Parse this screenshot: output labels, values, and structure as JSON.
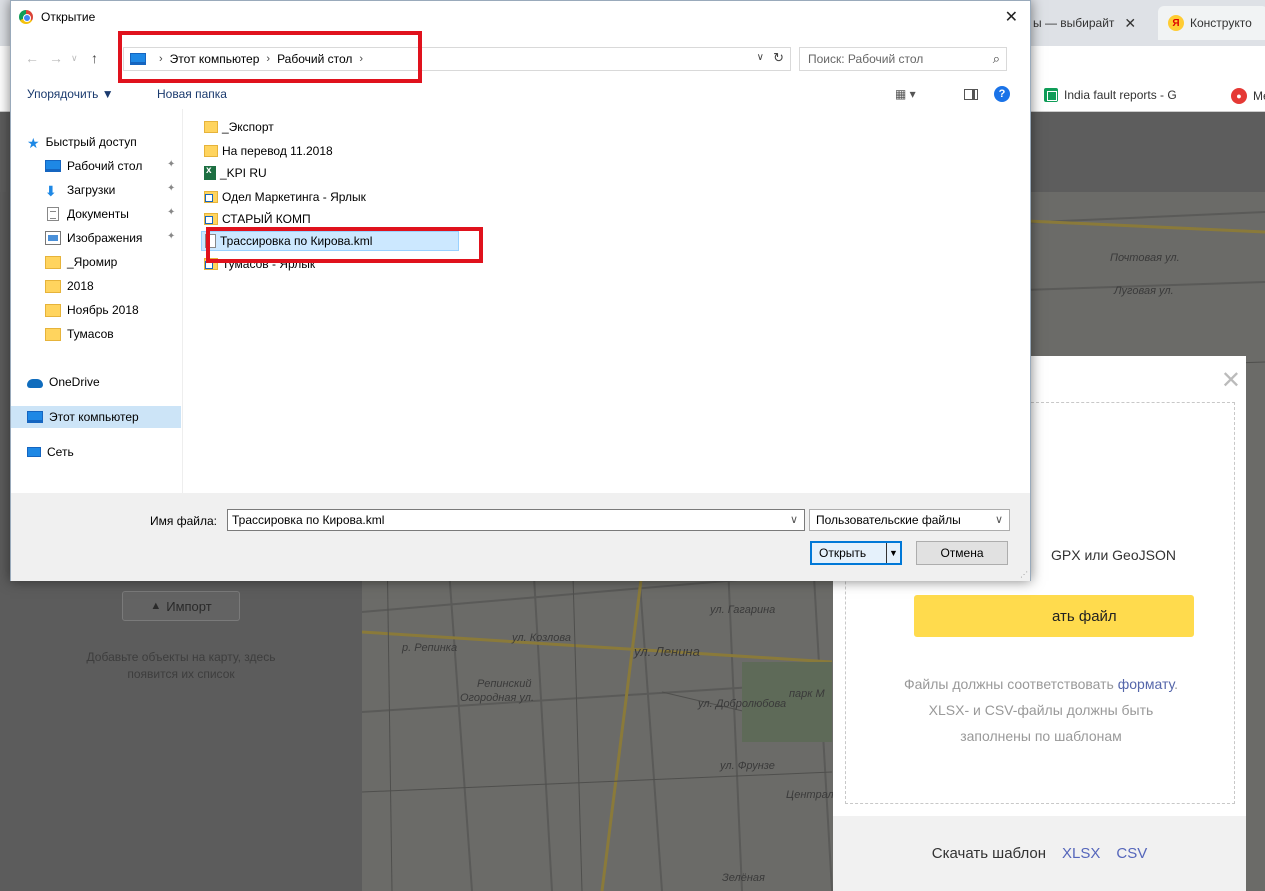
{
  "browser": {
    "tabs": [
      {
        "label": "ы — выбирайт",
        "close": "✕"
      },
      {
        "label": "Конструкто"
      }
    ],
    "bookmarks": [
      {
        "label": "India fault reports - G"
      },
      {
        "label": "Me"
      }
    ]
  },
  "map": {
    "streets": [
      "ул. Гагарина",
      "ул. Ленина",
      "ул. Козлова",
      "р. Репинка",
      "Репинский",
      "парк М",
      "ул. Добролюбова",
      "ул. Фрунзе",
      "Централь",
      "Огородная ул.",
      "Почтовая ул.",
      "Луговая ул.",
      "Зелёная"
    ]
  },
  "app": {
    "import_button": "Импорт",
    "empty_hint": "Добавьте объекты на карту, здесь появится их список"
  },
  "modal": {
    "close": "✕",
    "formats": "GPX или GeoJSON",
    "upload_button": "ать файл",
    "req_prefix": "Файлы должны соответствовать ",
    "req_link": "формату",
    "req_suffix": ".",
    "req_line2": "XLSX- и CSV-файлы должны быть",
    "req_line3": "заполнены по шаблонам",
    "footer_label": "Скачать шаблон",
    "footer_xlsx": "XLSX",
    "footer_csv": "CSV"
  },
  "dialog": {
    "title": "Открытие",
    "close": "✕",
    "breadcrumb": [
      "Этот компьютер",
      "Рабочий стол"
    ],
    "search_placeholder": "Поиск: Рабочий стол",
    "toolbar": {
      "organize": "Упорядочить ▼",
      "new_folder": "Новая папка"
    },
    "nav_items": [
      {
        "label": "Быстрый доступ",
        "icon": "star-icon"
      },
      {
        "label": "Рабочий стол",
        "icon": "desktop-icon",
        "pinned": true
      },
      {
        "label": "Загрузки",
        "icon": "downloads-icon",
        "pinned": true
      },
      {
        "label": "Документы",
        "icon": "documents-icon",
        "pinned": true
      },
      {
        "label": "Изображения",
        "icon": "pictures-icon",
        "pinned": true
      },
      {
        "label": "_Яромир",
        "icon": "folder-icon"
      },
      {
        "label": "2018",
        "icon": "folder-icon"
      },
      {
        "label": "Ноябрь 2018",
        "icon": "folder-icon"
      },
      {
        "label": "Тумасов",
        "icon": "folder-icon"
      },
      {
        "label": "OneDrive",
        "icon": "onedrive-icon"
      },
      {
        "label": "Этот компьютер",
        "icon": "computer-icon",
        "selected": true
      },
      {
        "label": "Сеть",
        "icon": "network-icon"
      }
    ],
    "files": [
      {
        "name": "_Экспорт",
        "type": "folder"
      },
      {
        "name": "На перевод 11.2018",
        "type": "folder"
      },
      {
        "name": "_KPI RU",
        "type": "excel"
      },
      {
        "name": "Одел Маркетинга - Ярлык",
        "type": "shortcut"
      },
      {
        "name": "СТАРЫЙ КОМП",
        "type": "shortcut"
      },
      {
        "name": "Трассировка по Кирова.kml",
        "type": "file",
        "selected": true
      },
      {
        "name": "Тумасов - Ярлык",
        "type": "shortcut"
      }
    ],
    "filename_label": "Имя файла:",
    "filename_value": "Трассировка по Кирова.kml",
    "filetype_value": "Пользовательские файлы",
    "open_button": "Открыть",
    "cancel_button": "Отмена"
  },
  "colors": {
    "highlight": "#e0121d",
    "accent": "#0078d7",
    "upload_button": "#ffdb4d"
  }
}
